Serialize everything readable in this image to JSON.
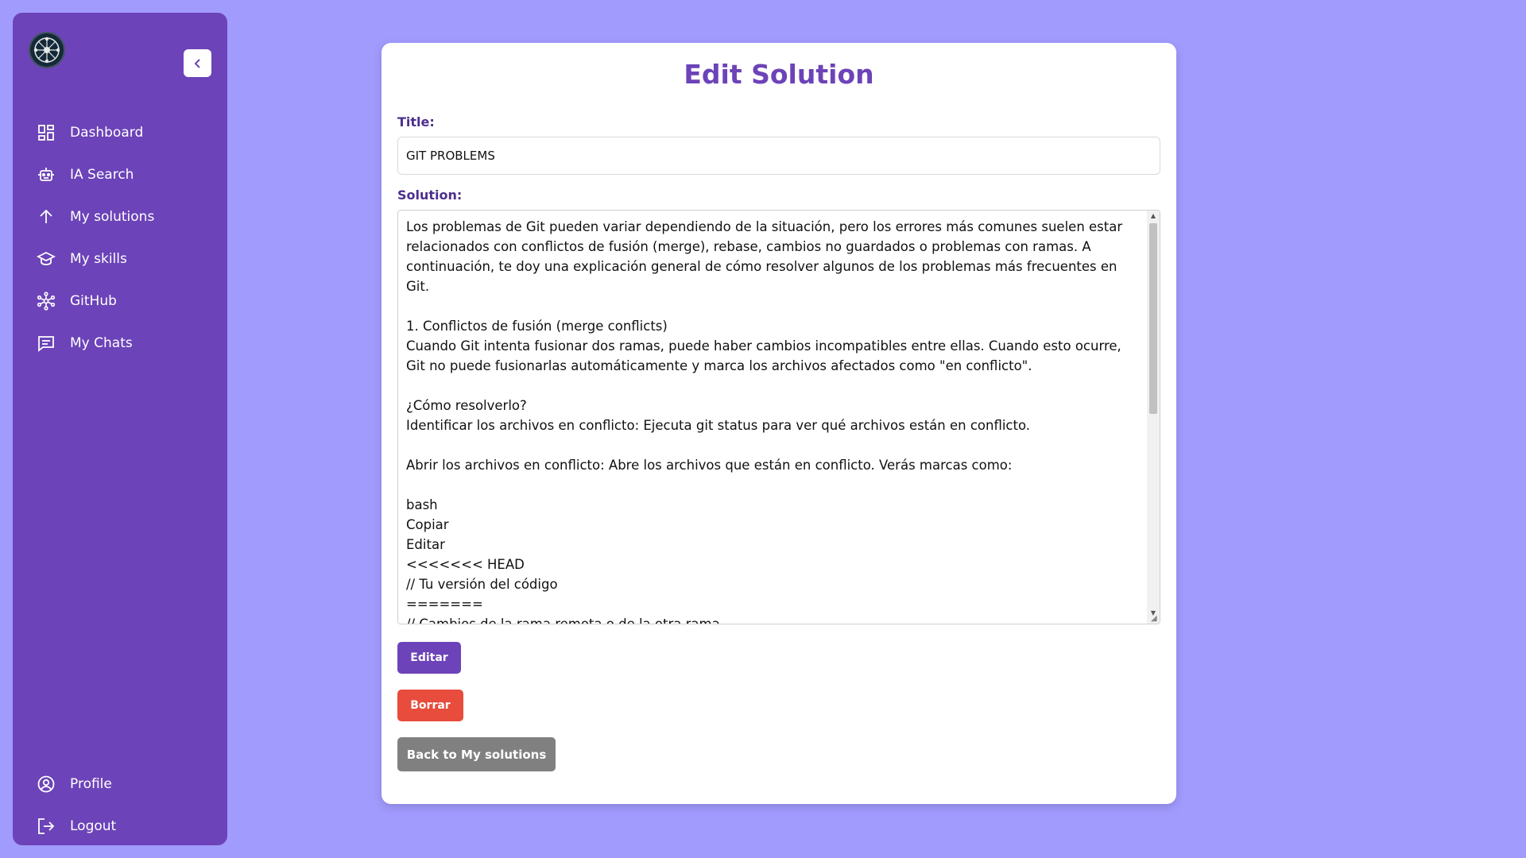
{
  "sidebar": {
    "logo": "logo-icon",
    "collapse_icon": "chevron-left-icon",
    "items": [
      {
        "label": "Dashboard",
        "icon": "dashboard-icon"
      },
      {
        "label": "IA Search",
        "icon": "robot-icon"
      },
      {
        "label": "My solutions",
        "icon": "arrow-up-icon"
      },
      {
        "label": "My skills",
        "icon": "graduation-cap-icon"
      },
      {
        "label": "GitHub",
        "icon": "network-icon"
      },
      {
        "label": "My Chats",
        "icon": "chat-icon"
      }
    ],
    "bottom_items": [
      {
        "label": "Profile",
        "icon": "user-circle-icon"
      },
      {
        "label": "Logout",
        "icon": "logout-icon"
      }
    ]
  },
  "form": {
    "heading": "Edit Solution",
    "title_label": "Title:",
    "title_value": "GIT PROBLEMS",
    "solution_label": "Solution:",
    "solution_value": "Los problemas de Git pueden variar dependiendo de la situación, pero los errores más comunes suelen estar relacionados con conflictos de fusión (merge), rebase, cambios no guardados o problemas con ramas. A continuación, te doy una explicación general de cómo resolver algunos de los problemas más frecuentes en Git.\n\n1. Conflictos de fusión (merge conflicts)\nCuando Git intenta fusionar dos ramas, puede haber cambios incompatibles entre ellas. Cuando esto ocurre, Git no puede fusionarlas automáticamente y marca los archivos afectados como \"en conflicto\".\n\n¿Cómo resolverlo?\nIdentificar los archivos en conflicto: Ejecuta git status para ver qué archivos están en conflicto.\n\nAbrir los archivos en conflicto: Abre los archivos que están en conflicto. Verás marcas como:\n\nbash\nCopiar\nEditar\n<<<<<<< HEAD\n// Tu versión del código\n=======\n// Cambios de la rama remota o de la otra rama\n>>>>>>> rama-remota",
    "edit_button": "Editar",
    "delete_button": "Borrar",
    "back_button": "Back to My solutions"
  },
  "colors": {
    "background": "#a29bfe",
    "sidebar": "#6c43b8",
    "accent": "#6c43b8",
    "danger": "#e74c3c",
    "secondary": "#808080"
  }
}
